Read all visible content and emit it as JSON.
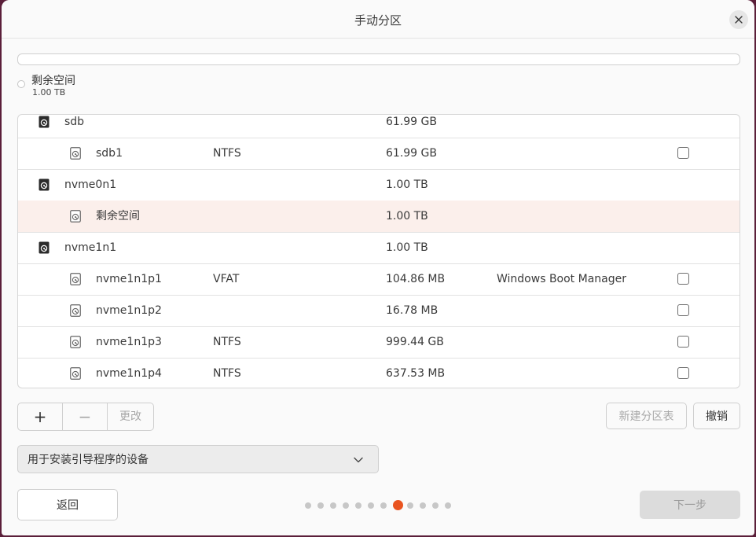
{
  "window": {
    "title": "手动分区"
  },
  "free_space_legend": {
    "label": "剩余空间",
    "size": "1.00 TB"
  },
  "partitions": [
    {
      "kind": "disk",
      "name": "sdb",
      "fs": "",
      "size": "61.99 GB",
      "label": "",
      "checkbox": false
    },
    {
      "kind": "part",
      "name": "sdb1",
      "fs": "NTFS",
      "size": "61.99 GB",
      "label": "",
      "checkbox": true,
      "checked": false
    },
    {
      "kind": "disk",
      "name": "nvme0n1",
      "fs": "",
      "size": "1.00 TB",
      "label": "",
      "checkbox": false
    },
    {
      "kind": "part",
      "name": "剩余空间",
      "fs": "",
      "size": "1.00 TB",
      "label": "",
      "checkbox": false,
      "selected": true
    },
    {
      "kind": "disk",
      "name": "nvme1n1",
      "fs": "",
      "size": "1.00 TB",
      "label": "",
      "checkbox": false
    },
    {
      "kind": "part",
      "name": "nvme1n1p1",
      "fs": "VFAT",
      "size": "104.86 MB",
      "label": "Windows Boot Manager",
      "checkbox": true,
      "checked": false
    },
    {
      "kind": "part",
      "name": "nvme1n1p2",
      "fs": "",
      "size": "16.78 MB",
      "label": "",
      "checkbox": true,
      "checked": false
    },
    {
      "kind": "part",
      "name": "nvme1n1p3",
      "fs": "NTFS",
      "size": "999.44 GB",
      "label": "",
      "checkbox": true,
      "checked": false
    },
    {
      "kind": "part",
      "name": "nvme1n1p4",
      "fs": "NTFS",
      "size": "637.53 MB",
      "label": "",
      "checkbox": true,
      "checked": false
    }
  ],
  "toolbar": {
    "add_label": "+",
    "remove_label": "−",
    "change_label": "更改",
    "new_table_label": "新建分区表",
    "revert_label": "撤销"
  },
  "bootloader": {
    "selected": "用于安装引导程序的设备"
  },
  "navigation": {
    "back_label": "返回",
    "next_label": "下一步",
    "page_count": 12,
    "current_page": 8
  },
  "colors": {
    "accent": "#e95420",
    "selected_row": "#fbefeb",
    "window_frame": "#5b1f3a"
  }
}
